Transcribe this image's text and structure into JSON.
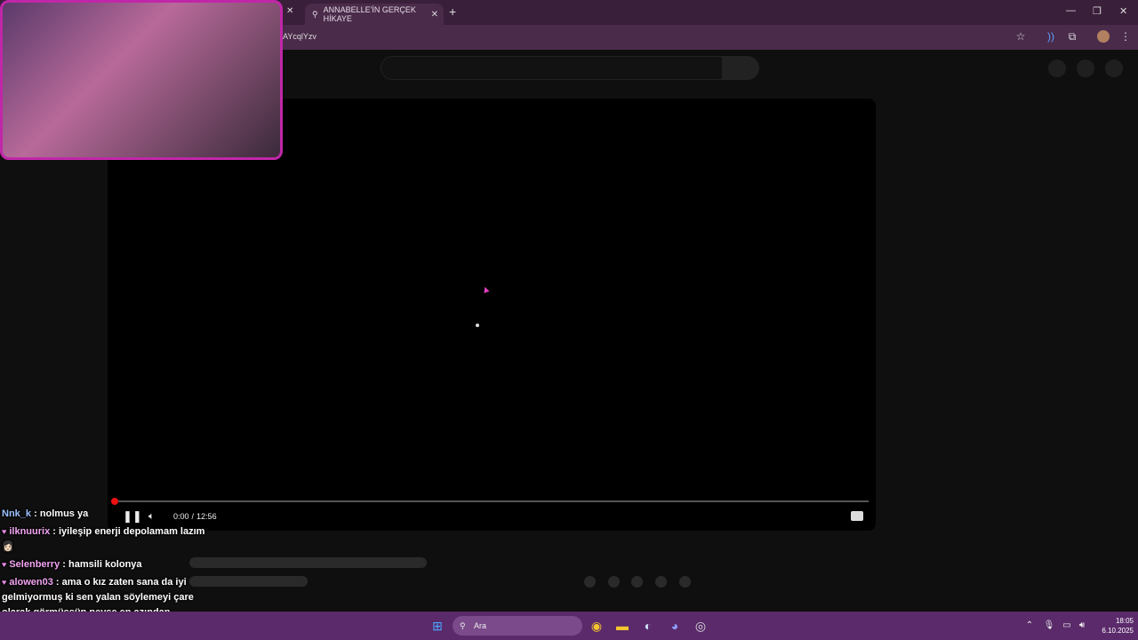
{
  "browser": {
    "active_tab_title": "ANNABELLE'İN GERÇEK HİKAYE",
    "url_visible": "AYcqlYzv"
  },
  "player": {
    "time_current": "0:00",
    "time_separator": "/",
    "time_total": "12:56",
    "progress": 0.0
  },
  "chat": {
    "messages": [
      {
        "user": "Nnk_k",
        "sep": " : ",
        "text": "nolmus ya",
        "color": "#9bc0ff",
        "badge": false
      },
      {
        "user": "ilknuurix",
        "sep": " : ",
        "text": "iyileşip enerji depolamam lazım 👩🏻",
        "color": "#f2a4f2",
        "badge": true
      },
      {
        "user": "Selenberry",
        "sep": " : ",
        "text": "hamsili kolonya",
        "color": "#f2a4f2",
        "badge": true
      },
      {
        "user": "alowen03",
        "sep": " : ",
        "text": "ama o kız zaten sana da iyi gelmiyormuş ki sen yalan söylemeyi çare olarak görmüşsün neyse en azından denedin!",
        "color": "#f2a4f2",
        "badge": true
      }
    ]
  },
  "taskbar": {
    "search_placeholder": "Ara",
    "time": "18:05",
    "date": "6.10.2025"
  },
  "icons": {
    "tab_favicon": "link-icon",
    "star": "star-icon",
    "extensions": "puzzle-icon",
    "menu": "kebab-menu-icon"
  }
}
